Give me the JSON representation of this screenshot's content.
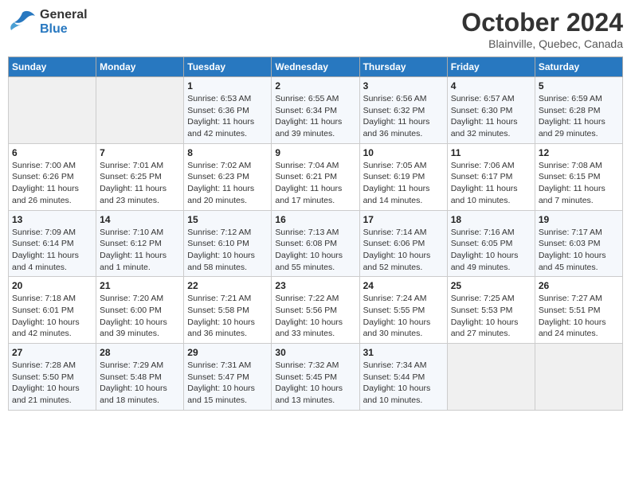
{
  "logo": {
    "line1": "General",
    "line2": "Blue"
  },
  "title": "October 2024",
  "subtitle": "Blainville, Quebec, Canada",
  "weekdays": [
    "Sunday",
    "Monday",
    "Tuesday",
    "Wednesday",
    "Thursday",
    "Friday",
    "Saturday"
  ],
  "weeks": [
    [
      {
        "day": "",
        "info": ""
      },
      {
        "day": "",
        "info": ""
      },
      {
        "day": "1",
        "info": "Sunrise: 6:53 AM\nSunset: 6:36 PM\nDaylight: 11 hours and 42 minutes."
      },
      {
        "day": "2",
        "info": "Sunrise: 6:55 AM\nSunset: 6:34 PM\nDaylight: 11 hours and 39 minutes."
      },
      {
        "day": "3",
        "info": "Sunrise: 6:56 AM\nSunset: 6:32 PM\nDaylight: 11 hours and 36 minutes."
      },
      {
        "day": "4",
        "info": "Sunrise: 6:57 AM\nSunset: 6:30 PM\nDaylight: 11 hours and 32 minutes."
      },
      {
        "day": "5",
        "info": "Sunrise: 6:59 AM\nSunset: 6:28 PM\nDaylight: 11 hours and 29 minutes."
      }
    ],
    [
      {
        "day": "6",
        "info": "Sunrise: 7:00 AM\nSunset: 6:26 PM\nDaylight: 11 hours and 26 minutes."
      },
      {
        "day": "7",
        "info": "Sunrise: 7:01 AM\nSunset: 6:25 PM\nDaylight: 11 hours and 23 minutes."
      },
      {
        "day": "8",
        "info": "Sunrise: 7:02 AM\nSunset: 6:23 PM\nDaylight: 11 hours and 20 minutes."
      },
      {
        "day": "9",
        "info": "Sunrise: 7:04 AM\nSunset: 6:21 PM\nDaylight: 11 hours and 17 minutes."
      },
      {
        "day": "10",
        "info": "Sunrise: 7:05 AM\nSunset: 6:19 PM\nDaylight: 11 hours and 14 minutes."
      },
      {
        "day": "11",
        "info": "Sunrise: 7:06 AM\nSunset: 6:17 PM\nDaylight: 11 hours and 10 minutes."
      },
      {
        "day": "12",
        "info": "Sunrise: 7:08 AM\nSunset: 6:15 PM\nDaylight: 11 hours and 7 minutes."
      }
    ],
    [
      {
        "day": "13",
        "info": "Sunrise: 7:09 AM\nSunset: 6:14 PM\nDaylight: 11 hours and 4 minutes."
      },
      {
        "day": "14",
        "info": "Sunrise: 7:10 AM\nSunset: 6:12 PM\nDaylight: 11 hours and 1 minute."
      },
      {
        "day": "15",
        "info": "Sunrise: 7:12 AM\nSunset: 6:10 PM\nDaylight: 10 hours and 58 minutes."
      },
      {
        "day": "16",
        "info": "Sunrise: 7:13 AM\nSunset: 6:08 PM\nDaylight: 10 hours and 55 minutes."
      },
      {
        "day": "17",
        "info": "Sunrise: 7:14 AM\nSunset: 6:06 PM\nDaylight: 10 hours and 52 minutes."
      },
      {
        "day": "18",
        "info": "Sunrise: 7:16 AM\nSunset: 6:05 PM\nDaylight: 10 hours and 49 minutes."
      },
      {
        "day": "19",
        "info": "Sunrise: 7:17 AM\nSunset: 6:03 PM\nDaylight: 10 hours and 45 minutes."
      }
    ],
    [
      {
        "day": "20",
        "info": "Sunrise: 7:18 AM\nSunset: 6:01 PM\nDaylight: 10 hours and 42 minutes."
      },
      {
        "day": "21",
        "info": "Sunrise: 7:20 AM\nSunset: 6:00 PM\nDaylight: 10 hours and 39 minutes."
      },
      {
        "day": "22",
        "info": "Sunrise: 7:21 AM\nSunset: 5:58 PM\nDaylight: 10 hours and 36 minutes."
      },
      {
        "day": "23",
        "info": "Sunrise: 7:22 AM\nSunset: 5:56 PM\nDaylight: 10 hours and 33 minutes."
      },
      {
        "day": "24",
        "info": "Sunrise: 7:24 AM\nSunset: 5:55 PM\nDaylight: 10 hours and 30 minutes."
      },
      {
        "day": "25",
        "info": "Sunrise: 7:25 AM\nSunset: 5:53 PM\nDaylight: 10 hours and 27 minutes."
      },
      {
        "day": "26",
        "info": "Sunrise: 7:27 AM\nSunset: 5:51 PM\nDaylight: 10 hours and 24 minutes."
      }
    ],
    [
      {
        "day": "27",
        "info": "Sunrise: 7:28 AM\nSunset: 5:50 PM\nDaylight: 10 hours and 21 minutes."
      },
      {
        "day": "28",
        "info": "Sunrise: 7:29 AM\nSunset: 5:48 PM\nDaylight: 10 hours and 18 minutes."
      },
      {
        "day": "29",
        "info": "Sunrise: 7:31 AM\nSunset: 5:47 PM\nDaylight: 10 hours and 15 minutes."
      },
      {
        "day": "30",
        "info": "Sunrise: 7:32 AM\nSunset: 5:45 PM\nDaylight: 10 hours and 13 minutes."
      },
      {
        "day": "31",
        "info": "Sunrise: 7:34 AM\nSunset: 5:44 PM\nDaylight: 10 hours and 10 minutes."
      },
      {
        "day": "",
        "info": ""
      },
      {
        "day": "",
        "info": ""
      }
    ]
  ]
}
